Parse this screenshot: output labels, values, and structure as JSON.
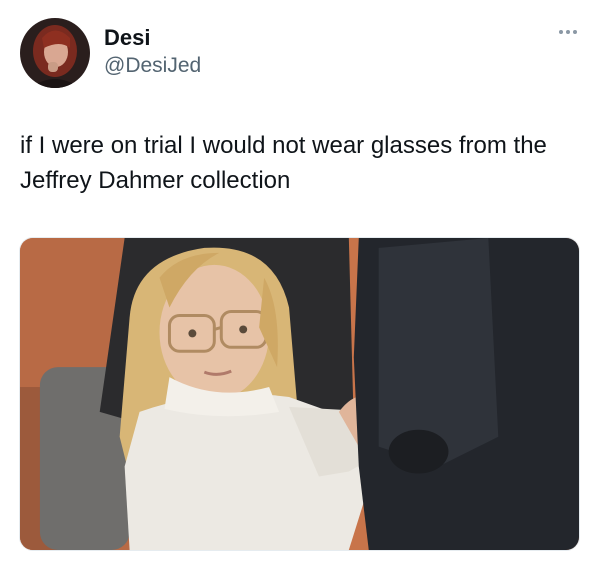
{
  "author": {
    "display_name": "Desi",
    "handle": "@DesiJed",
    "avatar_icon": "profile-avatar"
  },
  "tweet": {
    "text": "if I were on trial I would not wear glasses from the Jeffrey Dahmer collection"
  },
  "menu": {
    "icon": "more-options-icon"
  },
  "media": {
    "kind": "photo",
    "colors": {
      "wall": "#c8744a",
      "suit": "#23262c",
      "sweater": "#ece9e3",
      "hair": "#d8b676"
    }
  }
}
